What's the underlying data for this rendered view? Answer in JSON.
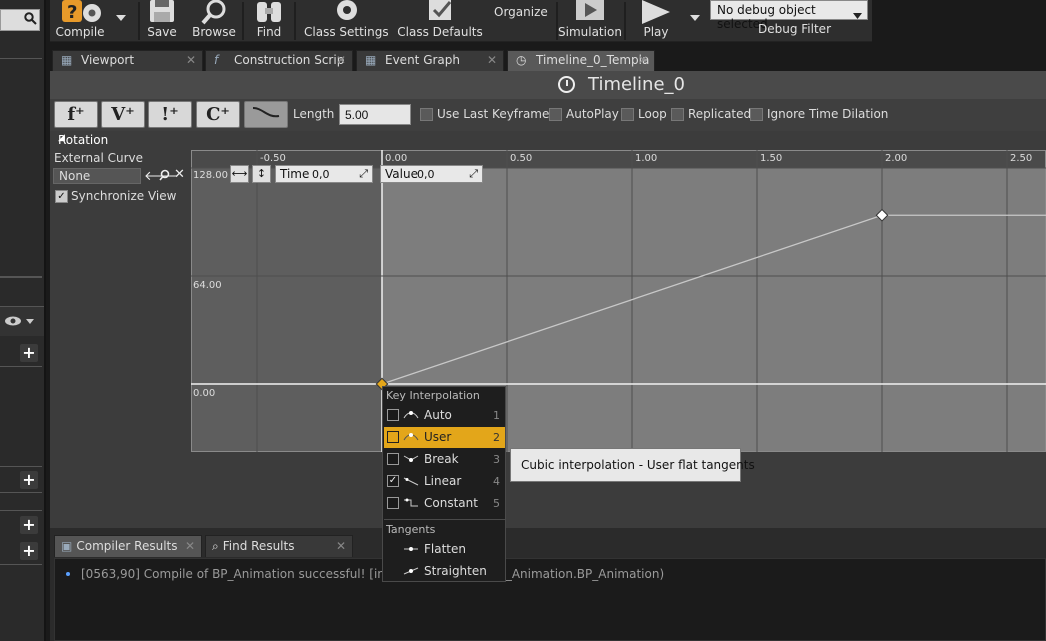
{
  "toolbar": {
    "compile": "Compile",
    "save": "Save",
    "browse": "Browse",
    "find": "Find",
    "class_settings": "Class Settings",
    "class_defaults": "Class Defaults",
    "organize": "Organize",
    "simulation": "Simulation",
    "play": "Play",
    "debug_select": "No debug object selected",
    "debug_filter": "Debug Filter"
  },
  "tabs": [
    {
      "label": "Viewport"
    },
    {
      "label": "Construction Scrip"
    },
    {
      "label": "Event Graph"
    },
    {
      "label": "Timeline_0_Templa"
    }
  ],
  "timeline": {
    "title": "Timeline_0",
    "length_label": "Length",
    "length_value": "5.00",
    "options": [
      "Use Last Keyframe?",
      "AutoPlay",
      "Loop",
      "Replicated",
      "Ignore Time Dilation"
    ]
  },
  "track": {
    "name": "Rotation",
    "external_curve_label": "External Curve",
    "curve_value": "None",
    "sync_label": "Synchronize View"
  },
  "graph": {
    "x_ticks": [
      "-0.50",
      "0.00",
      "0.50",
      "1.00",
      "1.50",
      "2.00",
      "2.50"
    ],
    "y_ticks": [
      "128.00",
      "64.00",
      "0.00"
    ],
    "time_label": "Time",
    "time_value": "0,0",
    "value_label": "Value",
    "value_value": "0,0",
    "keys": [
      {
        "time": 0.0,
        "value": 0.0
      },
      {
        "time": 2.0,
        "value": 100.0
      }
    ]
  },
  "menu": {
    "interp_heading": "Key Interpolation",
    "items": [
      {
        "label": "Auto",
        "shortcut": "1",
        "checked": false
      },
      {
        "label": "User",
        "shortcut": "2",
        "checked": false
      },
      {
        "label": "Break",
        "shortcut": "3",
        "checked": false
      },
      {
        "label": "Linear",
        "shortcut": "4",
        "checked": true
      },
      {
        "label": "Constant",
        "shortcut": "5",
        "checked": false
      }
    ],
    "tangents_heading": "Tangents",
    "tangents": [
      "Flatten",
      "Straighten"
    ]
  },
  "tooltip": "Cubic interpolation - User flat tangents",
  "bottom_tabs": [
    "Compiler Results",
    "Find Results"
  ],
  "log_line": "[0563,90] Compile of BP_Animation successful! [in 180 ms] (/Game/BP_Animation.BP_Animation)",
  "colors": {
    "accent": "#e3a61a",
    "graph_bg": "#7d7d7d",
    "curve": "#c8c8c8"
  }
}
